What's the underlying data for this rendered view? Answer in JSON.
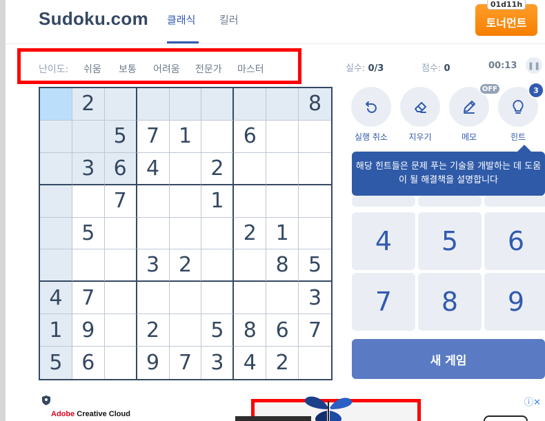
{
  "header": {
    "logo": "Sudoku.com",
    "tabs": [
      "클래식",
      "킬러"
    ],
    "active_tab": 0,
    "tournament_label": "토너먼트",
    "tournament_timer": "01d11h"
  },
  "difficulty": {
    "label": "난이도:",
    "options": [
      "쉬움",
      "보통",
      "어려움",
      "전문가",
      "마스터"
    ]
  },
  "stats": {
    "mistakes_label": "실수:",
    "mistakes_value": "0/3",
    "score_label": "점수:",
    "score_value": "0",
    "time": "00:13"
  },
  "board": {
    "rows": [
      [
        "",
        "2",
        "",
        "",
        "",
        "",
        "",
        "",
        "8"
      ],
      [
        "",
        "",
        "5",
        "7",
        "1",
        "",
        "6",
        "",
        ""
      ],
      [
        "",
        "3",
        "6",
        "4",
        "",
        "2",
        "",
        "",
        ""
      ],
      [
        "",
        "",
        "7",
        "",
        "",
        "1",
        "",
        "",
        ""
      ],
      [
        "",
        "5",
        "",
        "",
        "",
        "",
        "2",
        "1",
        ""
      ],
      [
        "",
        "",
        "",
        "3",
        "2",
        "",
        "",
        "8",
        "5"
      ],
      [
        "4",
        "7",
        "",
        "",
        "",
        "",
        "",
        "",
        "3"
      ],
      [
        "1",
        "9",
        "",
        "2",
        "",
        "5",
        "8",
        "6",
        "7"
      ],
      [
        "5",
        "6",
        "",
        "9",
        "7",
        "3",
        "4",
        "2",
        ""
      ]
    ],
    "selected": [
      0,
      0
    ]
  },
  "tools": {
    "undo_label": "실행 취소",
    "erase_label": "지우기",
    "notes_label": "메모",
    "notes_state": "OFF",
    "hint_label": "힌트",
    "hint_count": "3"
  },
  "tooltip": "해당 힌트들은 문제 푸는 기술을 개발하는 데 도움이 될 해결책을 설명합니다",
  "numpad": [
    "4",
    "5",
    "6",
    "7",
    "8",
    "9"
  ],
  "new_game_label": "새 게임",
  "ad": {
    "brand_prefix": "Adobe",
    "brand_rest": " Creative Cloud",
    "info_icon": "ⓘ✕"
  },
  "colors": {
    "accent": "#325aaf",
    "text": "#344861",
    "highlight": "#e2ebf3",
    "selected": "#bbdefb",
    "tournament": "#f77f00",
    "annotation_red": "#ff0000"
  }
}
